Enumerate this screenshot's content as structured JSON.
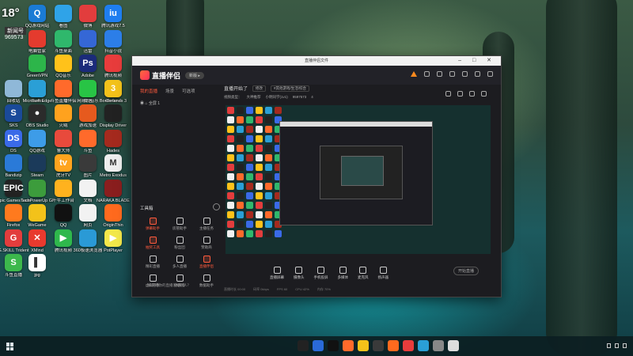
{
  "colors": {
    "accent": "#ff5a3d",
    "window_bg": "#1c1c20"
  },
  "weather": {
    "temp": "18°",
    "tag": "新闻号",
    "sub": "969573"
  },
  "desktop_icons": [
    {
      "label": "QQ游戏网站",
      "color": "#1a7bd5",
      "glyph": "Q"
    },
    {
      "label": "看图",
      "color": "#2fa3e8",
      "glyph": ""
    },
    {
      "label": "微博",
      "color": "#e23d3d",
      "glyph": ""
    },
    {
      "label": "腾讯游戏7.5",
      "color": "#1e7ef0",
      "glyph": "iu"
    },
    {
      "label": "电脑管家",
      "color": "#e43b2e",
      "glyph": ""
    },
    {
      "label": "斗鱼桌面",
      "color": "#2fb86c",
      "glyph": ""
    },
    {
      "label": "迅雷",
      "color": "#3567d6",
      "glyph": ""
    },
    {
      "label": "抖音小说",
      "color": "#2c7ee8",
      "glyph": ""
    },
    {
      "label": "GreenVPN",
      "color": "#2db54a",
      "glyph": ""
    },
    {
      "label": "QQ音乐",
      "color": "#ffc21a",
      "glyph": ""
    },
    {
      "label": "Adobe",
      "color": "#1b2b7a",
      "glyph": "Ps"
    },
    {
      "label": "腾讯视频",
      "color": "#e83c3c",
      "glyph": ""
    },
    {
      "label": "iTunes",
      "color": "#f3f3f3",
      "glyph": "♪"
    },
    {
      "label": "火绒",
      "color": "#ff8a1e",
      "glyph": ""
    },
    {
      "label": "网易云音乐",
      "color": "#e83030",
      "glyph": ""
    },
    {
      "label": "Chrome",
      "color": "#e7e7e7",
      "glyph": ""
    },
    {
      "label": "回收站",
      "color": "#8fb8d8",
      "glyph": ""
    },
    {
      "label": "Microsoft Edge",
      "color": "#2a9fd6",
      "glyph": ""
    },
    {
      "label": "斗鱼直播伴侣",
      "color": "#ff6a2b",
      "glyph": ""
    },
    {
      "label": "微信",
      "color": "#28c445",
      "glyph": ""
    },
    {
      "label": "Borderlands 3",
      "color": "#f3c21a",
      "glyph": "3"
    },
    {
      "label": "SKS",
      "color": "#1a4a9a",
      "glyph": "S"
    },
    {
      "label": "OBS Studio",
      "color": "#2b2b2b",
      "glyph": "●"
    },
    {
      "label": "火绒",
      "color": "#ffa21e",
      "glyph": ""
    },
    {
      "label": "游戏加速",
      "color": "#e65a1e",
      "glyph": ""
    },
    {
      "label": "Display Driver",
      "color": "#222",
      "glyph": ""
    },
    {
      "label": "DS",
      "color": "#3a6ae8",
      "glyph": "DS"
    },
    {
      "label": "QQ游戏",
      "color": "#3d9ce8",
      "glyph": ""
    },
    {
      "label": "鲁大师",
      "color": "#e84a3c",
      "glyph": ""
    },
    {
      "label": "斗鱼",
      "color": "#ff6a2b",
      "glyph": ""
    },
    {
      "label": "Hades",
      "color": "#a52a1e",
      "glyph": ""
    },
    {
      "label": "Bandizip",
      "color": "#2a7ad8",
      "glyph": ""
    },
    {
      "label": "Steam",
      "color": "#1b3a5a",
      "glyph": ""
    },
    {
      "label": "虎牙TV",
      "color": "#ffa41e",
      "glyph": "tv"
    },
    {
      "label": "图片",
      "color": "#3a3a3a",
      "glyph": ""
    },
    {
      "label": "Metro Exodus",
      "color": "#eeeeee",
      "glyph": "M"
    },
    {
      "label": "Epic Games Launcher",
      "color": "#222",
      "glyph": "EPIC"
    },
    {
      "label": "TechPowerUp GPU-Z",
      "color": "#3c9c3c",
      "glyph": ""
    },
    {
      "label": "千牛工作台",
      "color": "#ffb21e",
      "glyph": ""
    },
    {
      "label": "文档",
      "color": "#f2f2f2",
      "glyph": ""
    },
    {
      "label": "NARAKA BLADEPOINT",
      "color": "#8a1e1e",
      "glyph": ""
    },
    {
      "label": "Firefox",
      "color": "#ff7a1e",
      "glyph": ""
    },
    {
      "label": "WeGame",
      "color": "#f3c21a",
      "glyph": ""
    },
    {
      "label": "QQ",
      "color": "#111",
      "glyph": ""
    },
    {
      "label": "网页",
      "color": "#f2f2f2",
      "glyph": ""
    },
    {
      "label": "OriginThin",
      "color": "#ff6a1e",
      "glyph": ""
    },
    {
      "label": "G.SKILL Trident",
      "color": "#e23d3d",
      "glyph": "G"
    },
    {
      "label": "XMind",
      "color": "#e83a2e",
      "glyph": "✕"
    },
    {
      "label": "腾讯视频",
      "color": "#2fb84c",
      "glyph": "▶"
    },
    {
      "label": "360极速浏览器",
      "color": "#2a9ad6",
      "glyph": ""
    },
    {
      "label": "PotPlayer",
      "color": "#f3e84a",
      "glyph": "▶"
    },
    {
      "label": "斗鱼直播",
      "color": "#3cb84c",
      "glyph": "S"
    },
    {
      "label": "jpg",
      "color": "#ffffff",
      "glyph": "▌"
    }
  ],
  "window": {
    "title": "直播伴侣文件",
    "controls": "– □ ✕"
  },
  "app": {
    "name": "直播伴侣",
    "version": "新版 ▸",
    "tabs": [
      "我的直播",
      "场景",
      "可选项"
    ],
    "scene": "全屏 1",
    "tools_title": "工具箱",
    "tools": [
      {
        "label": "弹幕助手",
        "red": true
      },
      {
        "label": "房管助手",
        "red": false
      },
      {
        "label": "主播任务",
        "red": false
      },
      {
        "label": "抽奖工具",
        "red": true
      },
      {
        "label": "粉丝团",
        "red": false
      },
      {
        "label": "赞助商",
        "red": false
      },
      {
        "label": "精彩直播",
        "red": false
      },
      {
        "label": "多人直播",
        "red": false
      },
      {
        "label": "直播伴侣",
        "red": true
      },
      {
        "label": "虚拟形象",
        "red": false
      },
      {
        "label": "弹幕墙",
        "red": false
      },
      {
        "label": "数据助手",
        "red": false
      }
    ],
    "feedback": "如何把你的直播发给别人？",
    "stream_title": "直播开始了",
    "edit_label": "修改",
    "category": "#其他游戏/生活/综合",
    "info2": [
      "视频类型：",
      "大神推荐",
      "小明同学(1v1)",
      "9597573",
      "4"
    ],
    "bottom": [
      {
        "label": "直播屏幕"
      },
      {
        "label": "摄像头"
      },
      {
        "label": "手机投屏"
      },
      {
        "label": "多媒体"
      },
      {
        "label": "麦克风"
      },
      {
        "label": "扬声器"
      }
    ],
    "start_button": "开始直播",
    "status": [
      "直播时长 00:00",
      "码率 0kbps",
      "FPS 60",
      "CPU 42%",
      "内存 70%"
    ]
  }
}
